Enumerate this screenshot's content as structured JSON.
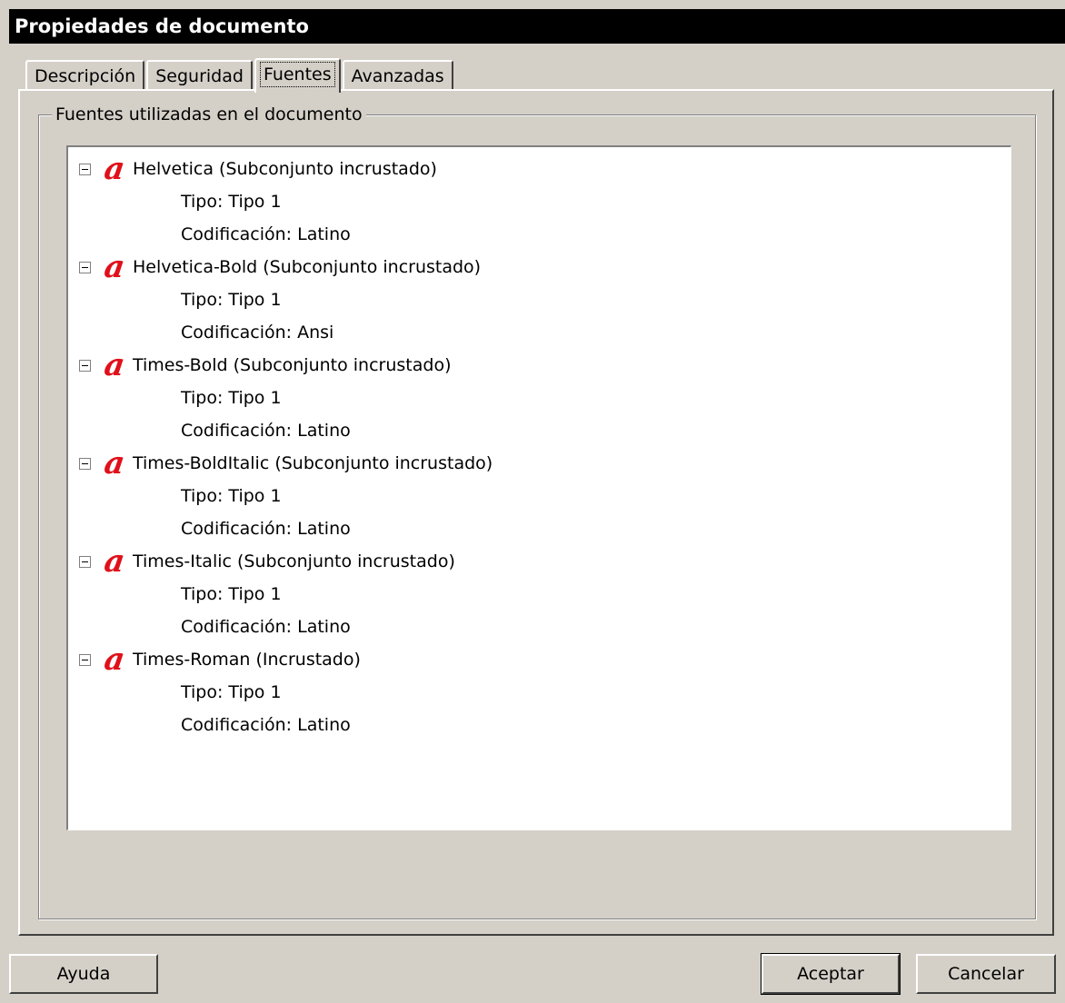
{
  "window": {
    "title": "Propiedades de documento"
  },
  "tabs": [
    {
      "label": "Descripción",
      "active": false
    },
    {
      "label": "Seguridad",
      "active": false
    },
    {
      "label": "Fuentes",
      "active": true
    },
    {
      "label": "Avanzadas",
      "active": false
    }
  ],
  "group": {
    "legend": "Fuentes utilizadas en el documento"
  },
  "fonts": [
    {
      "name": "Helvetica (Subconjunto incrustado)",
      "tipo": "Tipo: Tipo 1",
      "codificacion": "Codificación: Latino"
    },
    {
      "name": "Helvetica-Bold (Subconjunto incrustado)",
      "tipo": "Tipo: Tipo 1",
      "codificacion": "Codificación: Ansi"
    },
    {
      "name": "Times-Bold (Subconjunto incrustado)",
      "tipo": "Tipo: Tipo 1",
      "codificacion": "Codificación: Latino"
    },
    {
      "name": "Times-BoldItalic (Subconjunto incrustado)",
      "tipo": "Tipo: Tipo 1",
      "codificacion": "Codificación: Latino"
    },
    {
      "name": "Times-Italic (Subconjunto incrustado)",
      "tipo": "Tipo: Tipo 1",
      "codificacion": "Codificación: Latino"
    },
    {
      "name": "Times-Roman (Incrustado)",
      "tipo": "Tipo: Tipo 1",
      "codificacion": "Codificación: Latino"
    }
  ],
  "icons": {
    "font": "font-type-icon",
    "expander": "collapse-minus-icon"
  },
  "colors": {
    "title_bar": "#000000",
    "font_icon": "#e0101a",
    "dialog_bg": "#d4d0c8"
  },
  "buttons": {
    "help": "Ayuda",
    "ok": "Aceptar",
    "cancel": "Cancelar"
  }
}
